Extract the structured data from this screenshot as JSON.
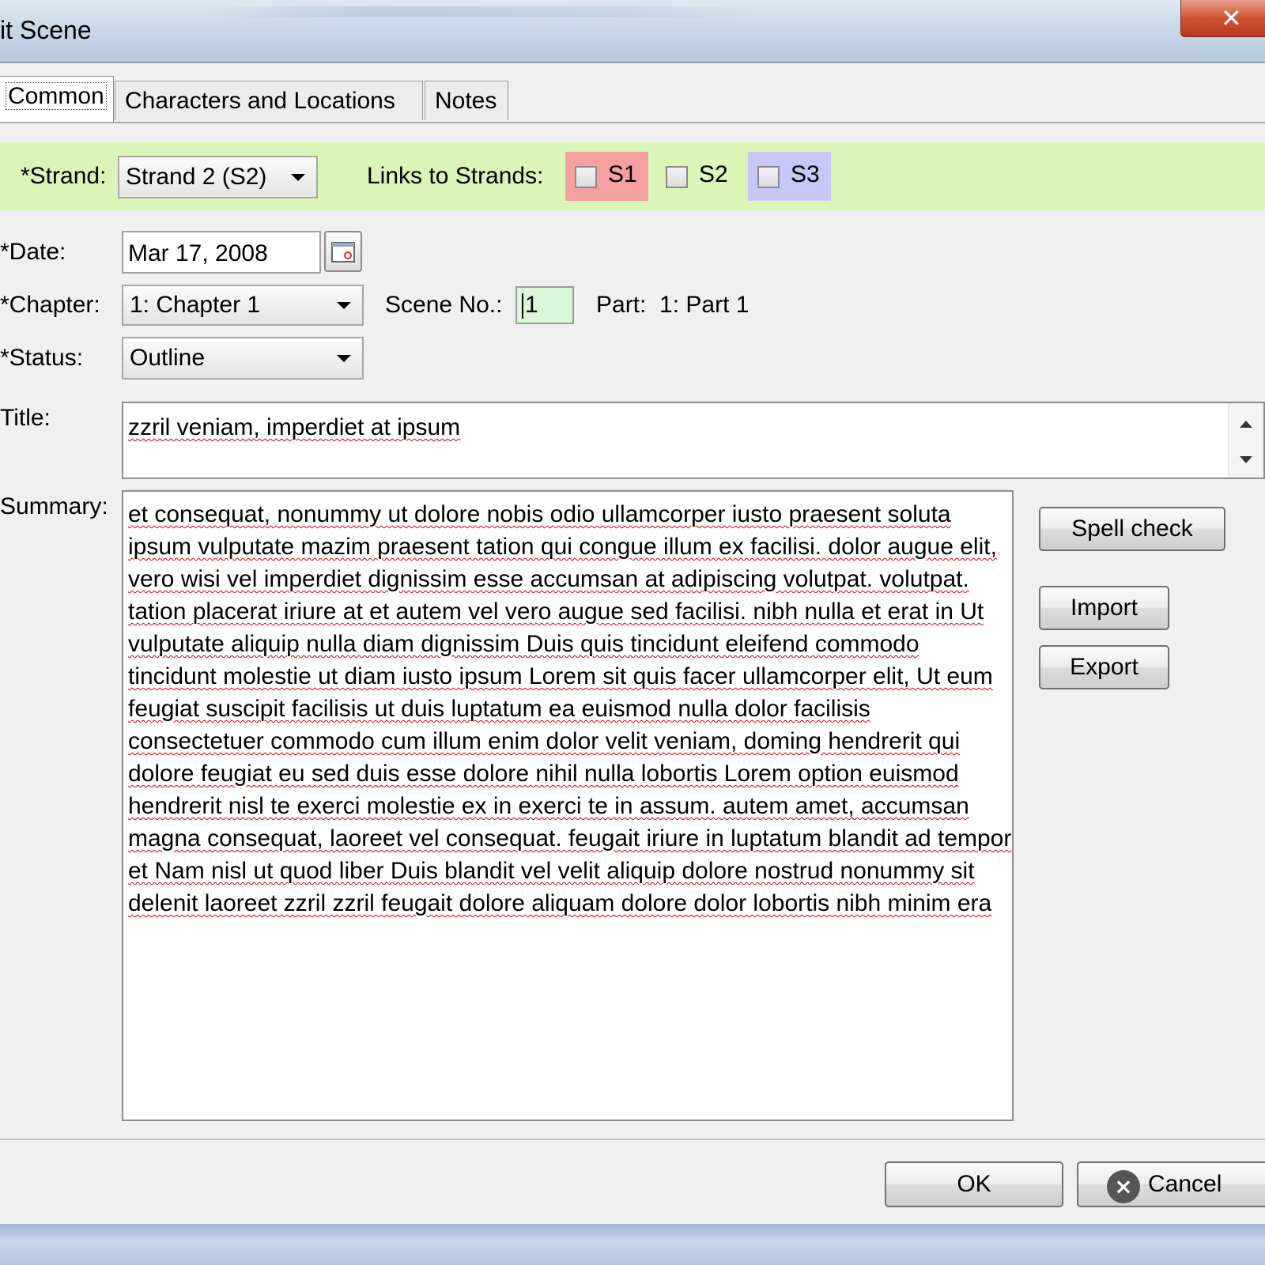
{
  "window": {
    "title": "it Scene",
    "close_glyph": "✕"
  },
  "tabs": [
    {
      "label": "Common",
      "active": true
    },
    {
      "label": "Characters and Locations",
      "active": false
    },
    {
      "label": "Notes",
      "active": false
    }
  ],
  "strand": {
    "label": "*Strand:",
    "value": "Strand 2 (S2)",
    "links_label": "Links to Strands:",
    "links": [
      {
        "label": "S1",
        "checked": false,
        "color": "#f5a0a0"
      },
      {
        "label": "S2",
        "checked": false,
        "color": "#d9f5b8"
      },
      {
        "label": "S3",
        "checked": false,
        "color": "#c8c8f8"
      }
    ],
    "bar_color": "#d9f5b8"
  },
  "form": {
    "date_label": "*Date:",
    "date_value": "Mar 17, 2008",
    "chapter_label": "*Chapter:",
    "chapter_value": "1: Chapter 1",
    "scene_no_label": "Scene No.:",
    "scene_no_value": "1",
    "part_label": "Part:",
    "part_value": "1: Part 1",
    "status_label": "*Status:",
    "status_value": "Outline",
    "title_label": "Title:",
    "title_value": "zzril veniam, imperdiet at ipsum",
    "summary_label": "Summary:",
    "summary_text": "et consequat, nonummy ut dolore nobis odio ullamcorper iusto praesent soluta ipsum vulputate mazim praesent tation qui congue illum ex facilisi. dolor augue elit, vero wisi vel imperdiet dignissim esse accumsan at adipiscing volutpat. volutpat. tation placerat iriure at et autem vel vero augue sed facilisi. nibh nulla et erat in Ut vulputate aliquip nulla diam dignissim Duis quis tincidunt eleifend commodo tincidunt molestie ut diam iusto ipsum Lorem sit quis facer ullamcorper elit, Ut eum feugiat suscipit facilisis ut duis luptatum ea euismod nulla dolor facilisis consectetuer commodo cum illum enim dolor velit veniam, doming hendrerit qui dolore feugiat eu sed duis esse dolore nihil nulla lobortis Lorem option euismod hendrerit nisl te exerci molestie ex in exerci te in assum. autem amet, accumsan magna consequat, laoreet vel consequat. feugait iriure in luptatum blandit ad tempor et Nam nisl ut quod liber Duis blandit vel velit aliquip dolore nostrud nonummy sit delenit laoreet zzril zzril feugait dolore aliquam dolore dolor lobortis nibh minim era"
  },
  "side_buttons": {
    "spell_check": "Spell check",
    "import": "Import",
    "export": "Export"
  },
  "footer": {
    "ok": "OK",
    "cancel": "Cancel"
  },
  "icons": {
    "calendar": "calendar-icon",
    "cancel": "cancel-x-icon",
    "close": "close-icon"
  }
}
